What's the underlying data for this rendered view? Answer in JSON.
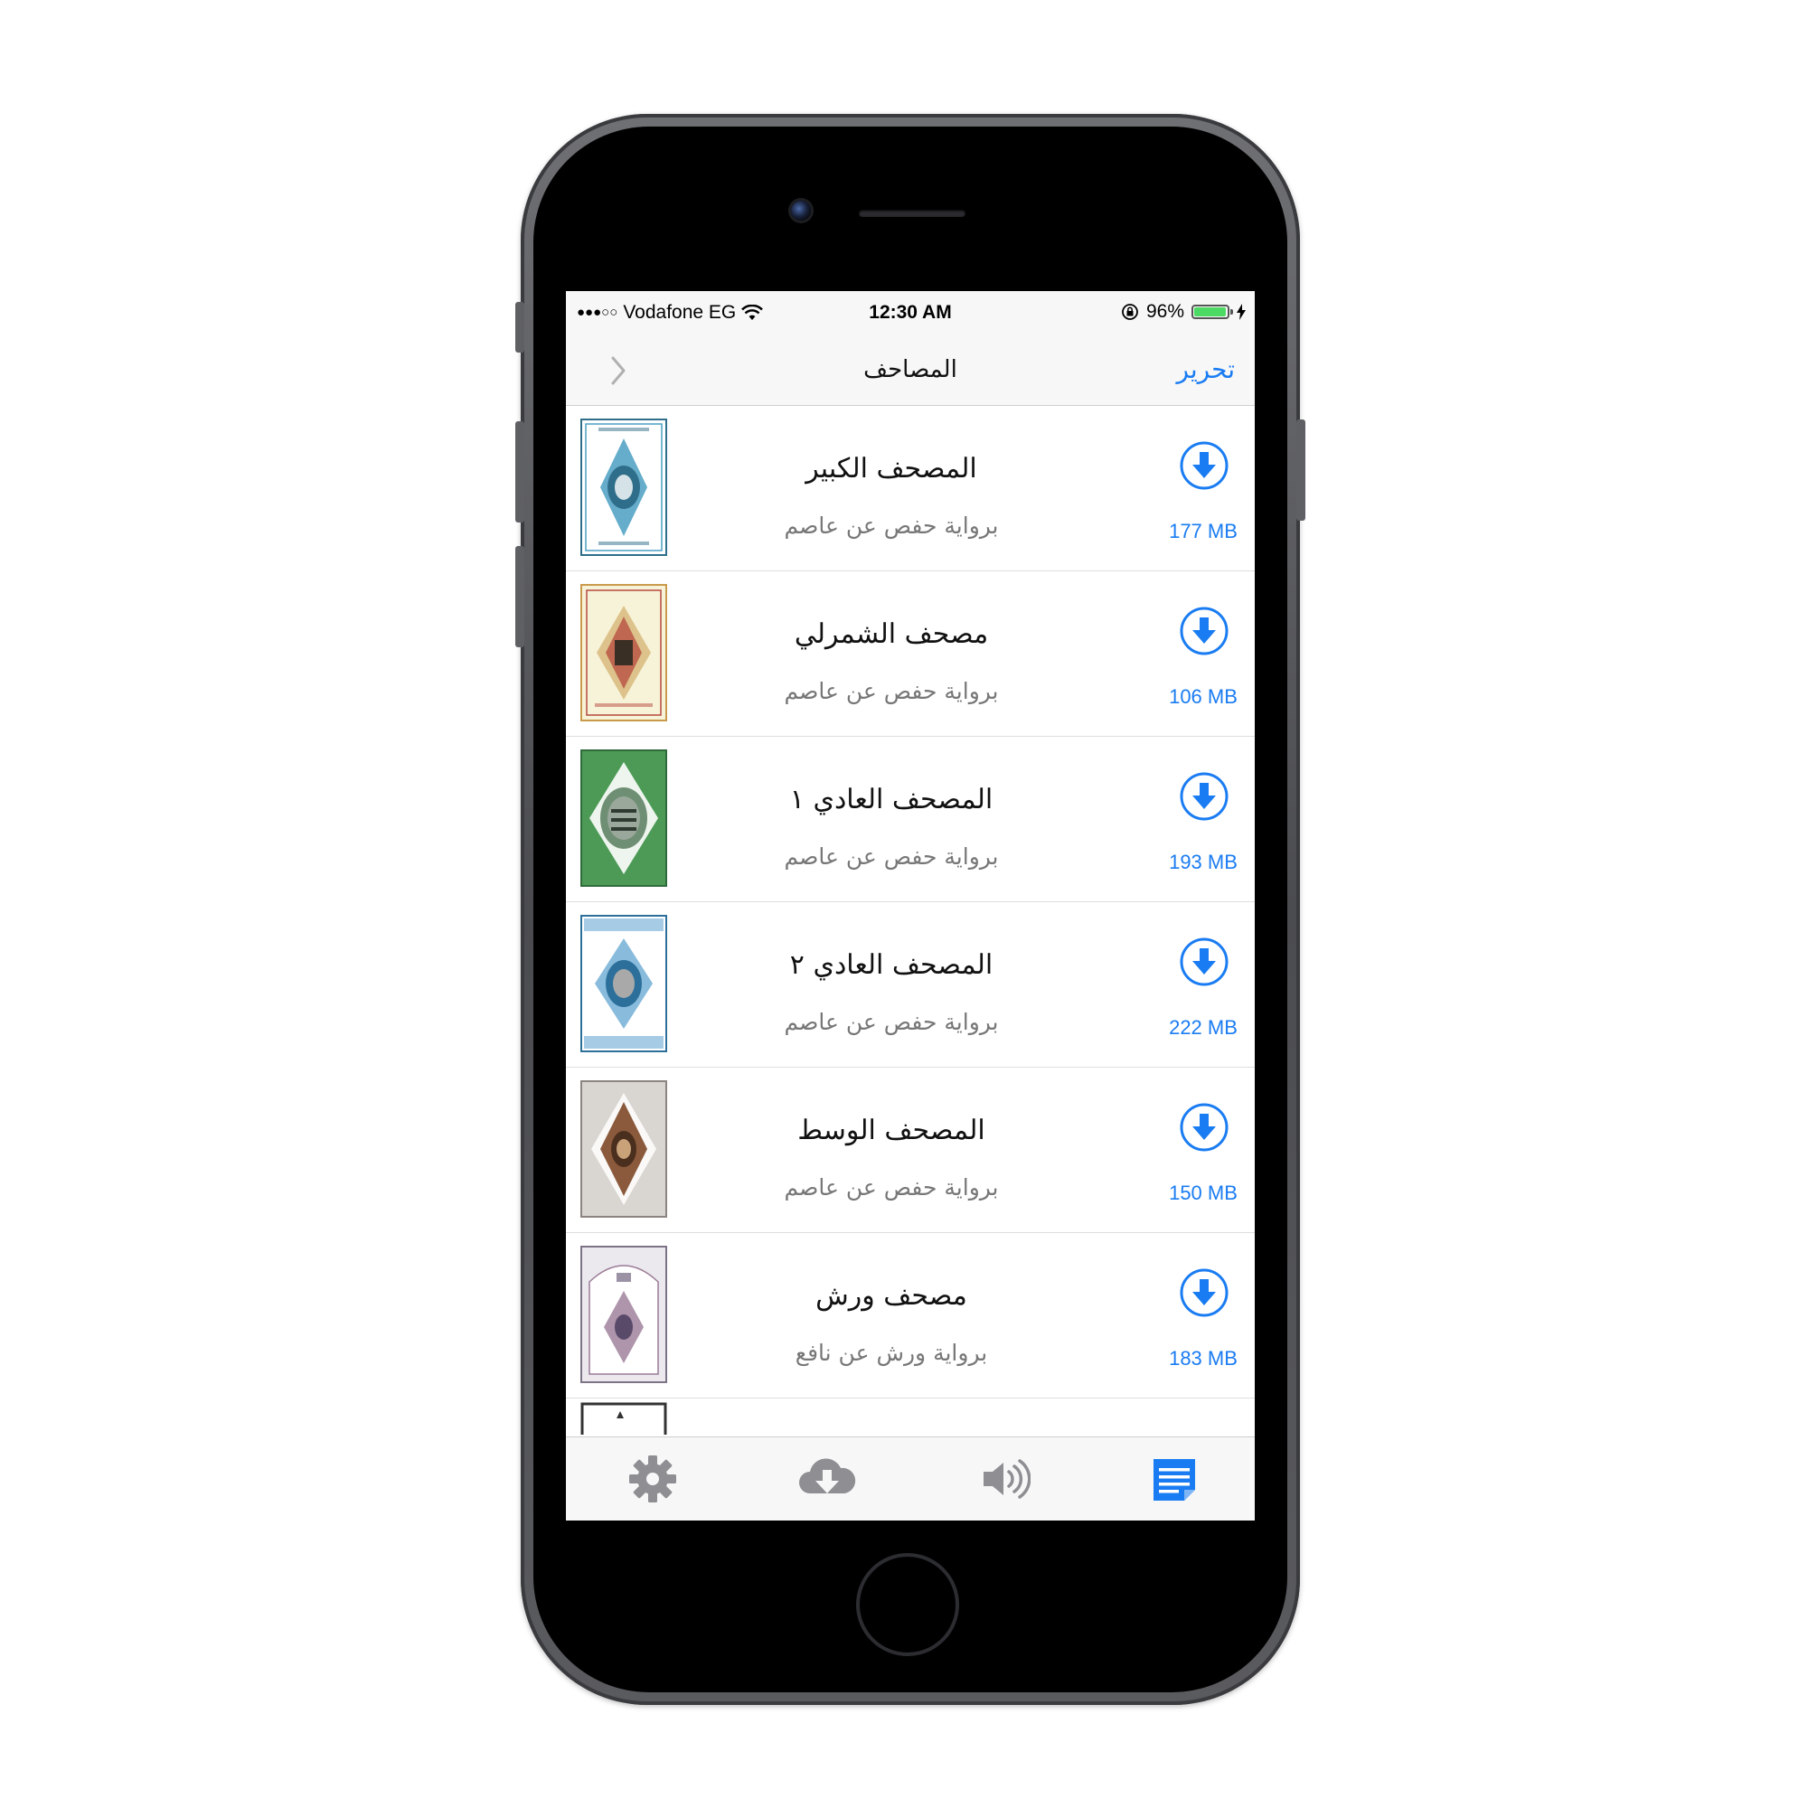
{
  "status_bar": {
    "signal": "●●●○○",
    "carrier": "Vodafone EG",
    "time": "12:30 AM",
    "battery_percent": "96%",
    "battery_level": 0.96,
    "icons": [
      "wifi-icon",
      "orientation-lock-icon",
      "battery-icon",
      "charging-icon"
    ]
  },
  "nav": {
    "title": "المصاحف",
    "edit_label": "تحرير",
    "back_icon": "chevron-icon"
  },
  "colors": {
    "accent": "#1a7cf2",
    "tab_inactive": "#8e8e93",
    "battery_green": "#4cd964"
  },
  "items": [
    {
      "title": "المصحف الكبير",
      "subtitle": "برواية حفص عن عاصم",
      "size": "177 MB",
      "cover_colors": [
        "#ffffff",
        "#4a9fc2",
        "#2f6e8a"
      ]
    },
    {
      "title": "مصحف الشمرلي",
      "subtitle": "برواية حفص عن عاصم",
      "size": "106 MB",
      "cover_colors": [
        "#f7f3d9",
        "#c99a4b",
        "#b5483d"
      ]
    },
    {
      "title": "المصحف العادي ١",
      "subtitle": "برواية حفص عن عاصم",
      "size": "193 MB",
      "cover_colors": [
        "#4c9a56",
        "#ffffff",
        "#2f6b3a"
      ]
    },
    {
      "title": "المصحف العادي ٢",
      "subtitle": "برواية حفص عن عاصم",
      "size": "222 MB",
      "cover_colors": [
        "#ffffff",
        "#6aaad3",
        "#2b6f9a"
      ]
    },
    {
      "title": "المصحف الوسط",
      "subtitle": "برواية حفص عن عاصم",
      "size": "150 MB",
      "cover_colors": [
        "#d9d6d1",
        "#8b5a3c",
        "#4b2f1e"
      ]
    },
    {
      "title": "مصحف ورش",
      "subtitle": "برواية ورش عن نافع",
      "size": "183 MB",
      "cover_colors": [
        "#ebe8ee",
        "#9a7b96",
        "#5a4a6a"
      ]
    }
  ],
  "tabs": [
    {
      "icon": "gear-icon",
      "active": false
    },
    {
      "icon": "cloud-download-icon",
      "active": false
    },
    {
      "icon": "speaker-icon",
      "active": false
    },
    {
      "icon": "document-list-icon",
      "active": true
    }
  ]
}
